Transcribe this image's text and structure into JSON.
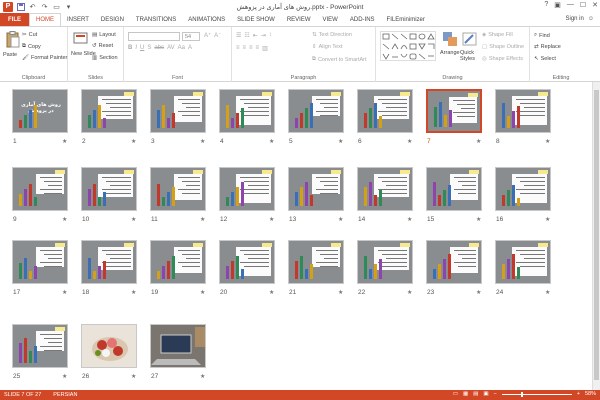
{
  "window": {
    "title": "روش های آماری در پزوهش.pptx - PowerPoint",
    "app_logo": "P",
    "controls": [
      "?",
      "▣",
      "—",
      "☐",
      "✕"
    ]
  },
  "tabs": [
    "FILE",
    "HOME",
    "INSERT",
    "DESIGN",
    "TRANSITIONS",
    "ANIMATIONS",
    "SLIDE SHOW",
    "REVIEW",
    "VIEW",
    "ADD-INS",
    "FILEminimizer"
  ],
  "active_tab": "HOME",
  "signin": "Sign in",
  "ribbon": {
    "clipboard": {
      "label": "Clipboard",
      "paste": "Paste",
      "cut": "Cut",
      "copy": "Copy",
      "format_painter": "Format Painter"
    },
    "slides": {
      "label": "Slides",
      "new_slide": "New Slide",
      "layout": "Layout",
      "reset": "Reset",
      "section": "Section"
    },
    "font": {
      "label": "Font",
      "size": "54"
    },
    "paragraph": {
      "label": "Paragraph",
      "text_direction": "Text Direction",
      "align_text": "Align Text",
      "convert": "Convert to SmartArt"
    },
    "drawing": {
      "label": "Drawing",
      "arrange": "Arrange",
      "quick_styles": "Quick Styles",
      "shape_fill": "Shape Fill",
      "shape_outline": "Shape Outline",
      "shape_effects": "Shape Effects"
    },
    "editing": {
      "label": "Editing",
      "find": "Find",
      "replace": "Replace",
      "select": "Select"
    }
  },
  "slides": [
    {
      "n": "1"
    },
    {
      "n": "2"
    },
    {
      "n": "3"
    },
    {
      "n": "4"
    },
    {
      "n": "5"
    },
    {
      "n": "6"
    },
    {
      "n": "7"
    },
    {
      "n": "8"
    },
    {
      "n": "9"
    },
    {
      "n": "10"
    },
    {
      "n": "11"
    },
    {
      "n": "12"
    },
    {
      "n": "13"
    },
    {
      "n": "14"
    },
    {
      "n": "15"
    },
    {
      "n": "16"
    },
    {
      "n": "17"
    },
    {
      "n": "18"
    },
    {
      "n": "19"
    },
    {
      "n": "20"
    },
    {
      "n": "21"
    },
    {
      "n": "22"
    },
    {
      "n": "23"
    },
    {
      "n": "24"
    },
    {
      "n": "25"
    },
    {
      "n": "26"
    },
    {
      "n": "27"
    }
  ],
  "slide1_title": "روش های آماری در پزوهش",
  "selected_slide": "7",
  "star": "★",
  "status": {
    "slide_of": "SLIDE 7 OF 27",
    "language": "PERSIAN",
    "zoom": "58%",
    "zoom_level": 0.58
  },
  "colors": {
    "accent": "#d24726"
  }
}
